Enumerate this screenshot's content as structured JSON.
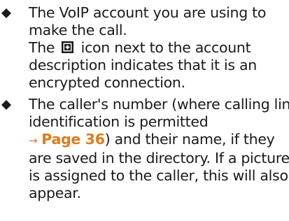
{
  "bullets": [
    {
      "icon": "diamond-bullet-icon",
      "lines": {
        "l1": "The VoIP account you are using to",
        "l2": "make the call.",
        "l3_pre": "The",
        "l3_icon": "lock-icon",
        "l3_post": "icon next to the account",
        "l4": "description indicates that it is an",
        "l5": "encrypted connection."
      }
    },
    {
      "icon": "diamond-bullet-icon",
      "lines": {
        "l1": "The caller's number (where calling line",
        "l2": "identification is permitted",
        "l3_arrow": "→",
        "l3_ref": "Page 36",
        "l3_post": ") and their name, if they",
        "l4": "are saved in the directory. If a picture",
        "l5": "is assigned to the caller, this will also",
        "l6": "appear."
      }
    }
  ],
  "colors": {
    "bullet": "#1a1a1a",
    "link": "#e07b1a",
    "text": "#1a1a1a"
  }
}
